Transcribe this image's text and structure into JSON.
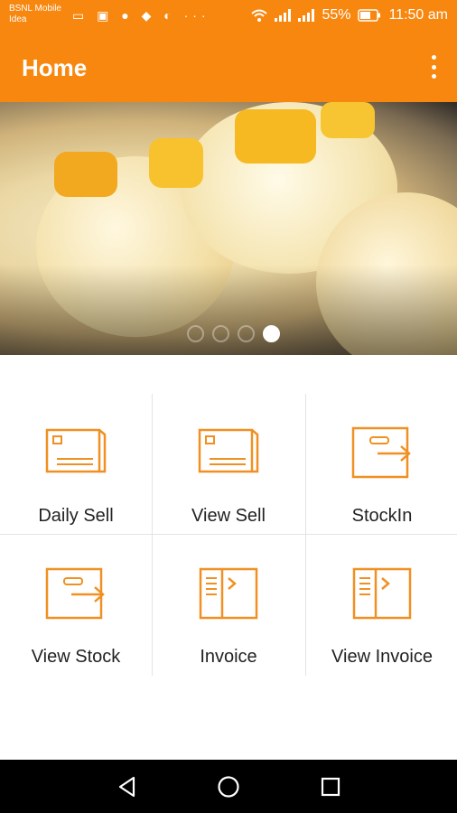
{
  "status_bar": {
    "carrier_line1": "BSNL Mobile",
    "carrier_line2": "Idea",
    "notification_icons": "▭ ▣ ● ◆ ◐ ···",
    "battery": "55%",
    "time": "11:50 am"
  },
  "app_bar": {
    "title": "Home",
    "menu_icon": "overflow-menu-icon"
  },
  "banner": {
    "slides_count": 4,
    "active_slide": 4
  },
  "menu": {
    "items": [
      {
        "label": "Daily Sell",
        "icon": "sell-card-icon"
      },
      {
        "label": "View Sell",
        "icon": "sell-card-icon"
      },
      {
        "label": "StockIn",
        "icon": "stock-transfer-icon"
      },
      {
        "label": "View Stock",
        "icon": "stock-transfer-icon"
      },
      {
        "label": "Invoice",
        "icon": "invoice-book-icon"
      },
      {
        "label": "View Invoice",
        "icon": "invoice-book-icon"
      }
    ]
  },
  "colors": {
    "accent": "#f7870f",
    "icon": "#f19022",
    "nav_bar": "#000000"
  }
}
